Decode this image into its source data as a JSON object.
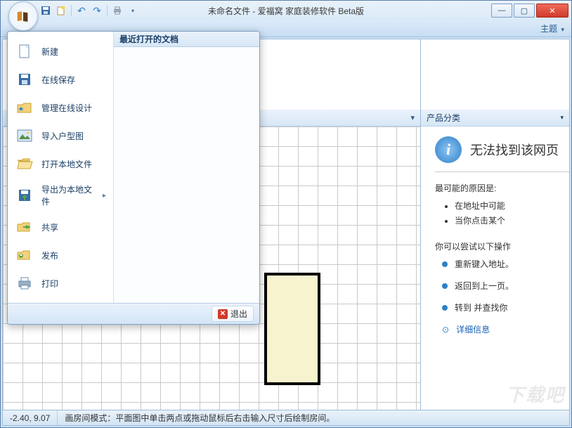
{
  "window": {
    "title": "未命名文件 - 爱福窝 家庭装修软件 Beta版"
  },
  "qat": {
    "save": "💾",
    "new": "✨",
    "undo": "↶",
    "redo": "↷",
    "print": "🖨"
  },
  "ribbon": {
    "theme_label": "主题"
  },
  "app_menu": {
    "recent_header": "最近打开的文档",
    "items": [
      {
        "key": "new",
        "label": "新建"
      },
      {
        "key": "save-online",
        "label": "在线保存"
      },
      {
        "key": "manage",
        "label": "管理在线设计"
      },
      {
        "key": "import-plan",
        "label": "导入户型图"
      },
      {
        "key": "open-local",
        "label": "打开本地文件"
      },
      {
        "key": "export-local",
        "label": "导出为本地文件",
        "has_submenu": true
      },
      {
        "key": "share",
        "label": "共享"
      },
      {
        "key": "publish",
        "label": "发布"
      },
      {
        "key": "print",
        "label": "打印"
      }
    ],
    "exit_label": "退出"
  },
  "right_panel": {
    "header": "产品分类",
    "error_title": "无法找到该网页",
    "cause_header": "最可能的原因是:",
    "causes": [
      "在地址中可能",
      "当你点击某个"
    ],
    "try_header": "你可以尝试以下操作",
    "tries": [
      "重新键入地址。",
      "返回到上一页。",
      "转到  并查找你"
    ],
    "details": "详细信息"
  },
  "statusbar": {
    "coords": "-2.40, 9.07",
    "hint": "画房间模式：平面图中单击两点或拖动鼠标后右击输入尺寸后绘制房间。"
  },
  "watermark": "下载吧"
}
